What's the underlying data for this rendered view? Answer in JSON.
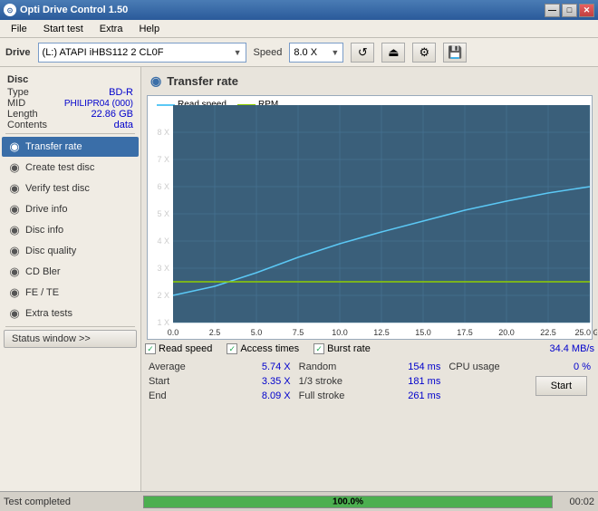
{
  "titleBar": {
    "title": "Opti Drive Control 1.50",
    "controls": {
      "minimize": "—",
      "maximize": "□",
      "close": "✕"
    }
  },
  "menu": {
    "items": [
      "File",
      "Start test",
      "Extra",
      "Help"
    ]
  },
  "driveBar": {
    "driveLabel": "Drive",
    "driveValue": "(L:)  ATAPI iHBS112  2 CL0F",
    "speedLabel": "Speed",
    "speedValue": "8.0 X"
  },
  "disc": {
    "sectionLabel": "Disc",
    "rows": [
      {
        "label": "Type",
        "value": "BD-R"
      },
      {
        "label": "MID",
        "value": "PHILIPR04 (000)"
      },
      {
        "label": "Length",
        "value": "22.86 GB"
      },
      {
        "label": "Contents",
        "value": "data"
      }
    ]
  },
  "sidebarItems": [
    {
      "id": "transfer-rate",
      "label": "Transfer rate",
      "active": true
    },
    {
      "id": "create-test-disc",
      "label": "Create test disc",
      "active": false
    },
    {
      "id": "verify-test-disc",
      "label": "Verify test disc",
      "active": false
    },
    {
      "id": "drive-info",
      "label": "Drive info",
      "active": false
    },
    {
      "id": "disc-info",
      "label": "Disc info",
      "active": false
    },
    {
      "id": "disc-quality",
      "label": "Disc quality",
      "active": false
    },
    {
      "id": "cd-bler",
      "label": "CD Bler",
      "active": false
    },
    {
      "id": "fe-te",
      "label": "FE / TE",
      "active": false
    },
    {
      "id": "extra-tests",
      "label": "Extra tests",
      "active": false
    }
  ],
  "statusWindowBtn": "Status window >>",
  "panelTitle": "Transfer rate",
  "chart": {
    "legend": [
      {
        "label": "Read speed",
        "color": "#5bc8f5"
      },
      {
        "label": "RPM",
        "color": "#8fce00"
      }
    ],
    "xAxis": {
      "label": "GB",
      "ticks": [
        "0.0",
        "2.5",
        "5.0",
        "7.5",
        "10.0",
        "12.5",
        "15.0",
        "17.5",
        "20.0",
        "22.5",
        "25.0"
      ]
    },
    "yAxis": {
      "ticks": [
        "1X",
        "2X",
        "3X",
        "4X",
        "5X",
        "6X",
        "7X",
        "8X"
      ]
    }
  },
  "checkboxes": [
    {
      "label": "Read speed",
      "checked": true
    },
    {
      "label": "Access times",
      "checked": true
    },
    {
      "label": "Burst rate",
      "checked": true
    }
  ],
  "burstRate": {
    "label": "Burst rate",
    "value": "34.4 MB/s"
  },
  "stats": {
    "left": [
      {
        "label": "Average",
        "value": "5.74 X"
      },
      {
        "label": "Start",
        "value": "3.35 X"
      },
      {
        "label": "End",
        "value": "8.09 X"
      }
    ],
    "middle": [
      {
        "label": "Random",
        "value": "154 ms"
      },
      {
        "label": "1/3 stroke",
        "value": "181 ms"
      },
      {
        "label": "Full stroke",
        "value": "261 ms"
      }
    ],
    "right": [
      {
        "label": "CPU usage",
        "value": "0 %"
      },
      {
        "label": "",
        "value": ""
      },
      {
        "label": "",
        "value": ""
      }
    ]
  },
  "startBtn": "Start",
  "statusBar": {
    "text": "Test completed",
    "progress": "100.0%",
    "time": "00:02"
  }
}
